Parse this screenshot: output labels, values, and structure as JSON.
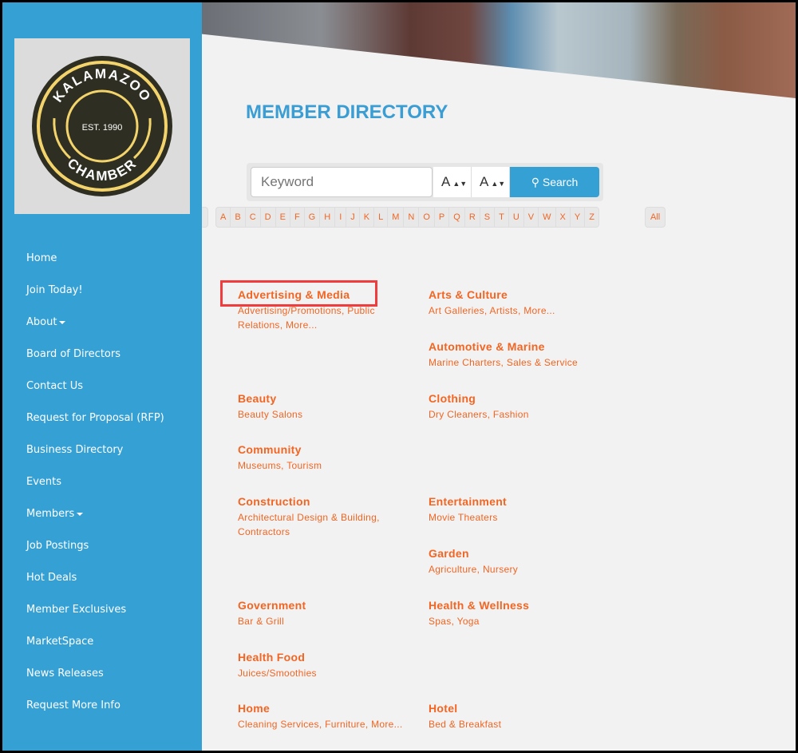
{
  "logo": {
    "top": "KALAMAZOO",
    "middle": "EST. 1990",
    "bottom": "CHAMBER"
  },
  "nav": [
    {
      "label": "Home"
    },
    {
      "label": "Join Today!"
    },
    {
      "label": "About",
      "dropdown": true
    },
    {
      "label": "Board of Directors"
    },
    {
      "label": "Contact Us"
    },
    {
      "label": "Request for Proposal (RFP)"
    },
    {
      "label": "Business Directory"
    },
    {
      "label": "Events"
    },
    {
      "label": "Members",
      "dropdown": true
    },
    {
      "label": "Job Postings"
    },
    {
      "label": "Hot Deals"
    },
    {
      "label": "Member Exclusives"
    },
    {
      "label": "MarketSpace"
    },
    {
      "label": "News Releases"
    },
    {
      "label": "Request More Info"
    }
  ],
  "title": "MEMBER DIRECTORY",
  "search": {
    "placeholder": "Keyword",
    "select1": "A",
    "select2": "A",
    "button": "Search"
  },
  "letters": [
    "A",
    "B",
    "C",
    "D",
    "E",
    "F",
    "G",
    "H",
    "I",
    "J",
    "K",
    "L",
    "M",
    "N",
    "O",
    "P",
    "Q",
    "R",
    "S",
    "T",
    "U",
    "V",
    "W",
    "X",
    "Y",
    "Z"
  ],
  "all_label": "All",
  "rows": [
    [
      {
        "name": "Advertising & Media",
        "subs": [
          "Advertising/Promotions",
          "Public Relations",
          "More..."
        ]
      },
      {
        "name": "Arts & Culture",
        "subs": [
          "Art Galleries",
          "Artists",
          "More..."
        ]
      }
    ],
    [
      null,
      {
        "name": "Automotive & Marine",
        "subs": [
          "Marine Charters",
          "Sales & Service"
        ]
      }
    ],
    [
      {
        "name": "Beauty",
        "subs": [
          "Beauty Salons"
        ]
      },
      {
        "name": "Clothing",
        "subs": [
          "Dry Cleaners",
          "Fashion"
        ]
      }
    ],
    [
      {
        "name": "Community",
        "subs": [
          "Museums",
          "Tourism"
        ]
      },
      null
    ],
    [
      {
        "name": "Construction",
        "subs": [
          "Architectural Design & Building",
          "Contractors"
        ]
      },
      {
        "name": "Entertainment",
        "subs": [
          "Movie Theaters"
        ]
      }
    ],
    [
      null,
      {
        "name": "Garden",
        "subs": [
          "Agriculture",
          "Nursery"
        ]
      }
    ],
    [
      {
        "name": "Government",
        "subs": [
          "Bar & Grill"
        ]
      },
      {
        "name": "Health & Wellness",
        "subs": [
          "Spas",
          "Yoga"
        ]
      }
    ],
    [
      {
        "name": "Health Food",
        "subs": [
          "Juices/Smoothies"
        ]
      },
      null
    ],
    [
      {
        "name": "Home",
        "subs": [
          "Cleaning Services",
          "Furniture",
          "More..."
        ]
      },
      {
        "name": "Hotel",
        "subs": [
          "Bed & Breakfast"
        ]
      }
    ]
  ]
}
